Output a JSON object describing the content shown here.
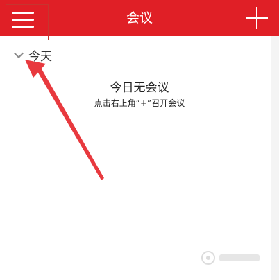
{
  "topbar": {
    "title": "会议",
    "menu_icon": "hamburger-menu-icon",
    "add_icon": "plus-icon",
    "color": "#e01f26"
  },
  "list": {
    "section_label": "今天",
    "section_icon": "chevron-down-icon"
  },
  "empty_state": {
    "title": "今日无会议",
    "hint": "点击右上角“+”召开会议"
  },
  "annotation": {
    "arrow_color": "#e8393e"
  }
}
